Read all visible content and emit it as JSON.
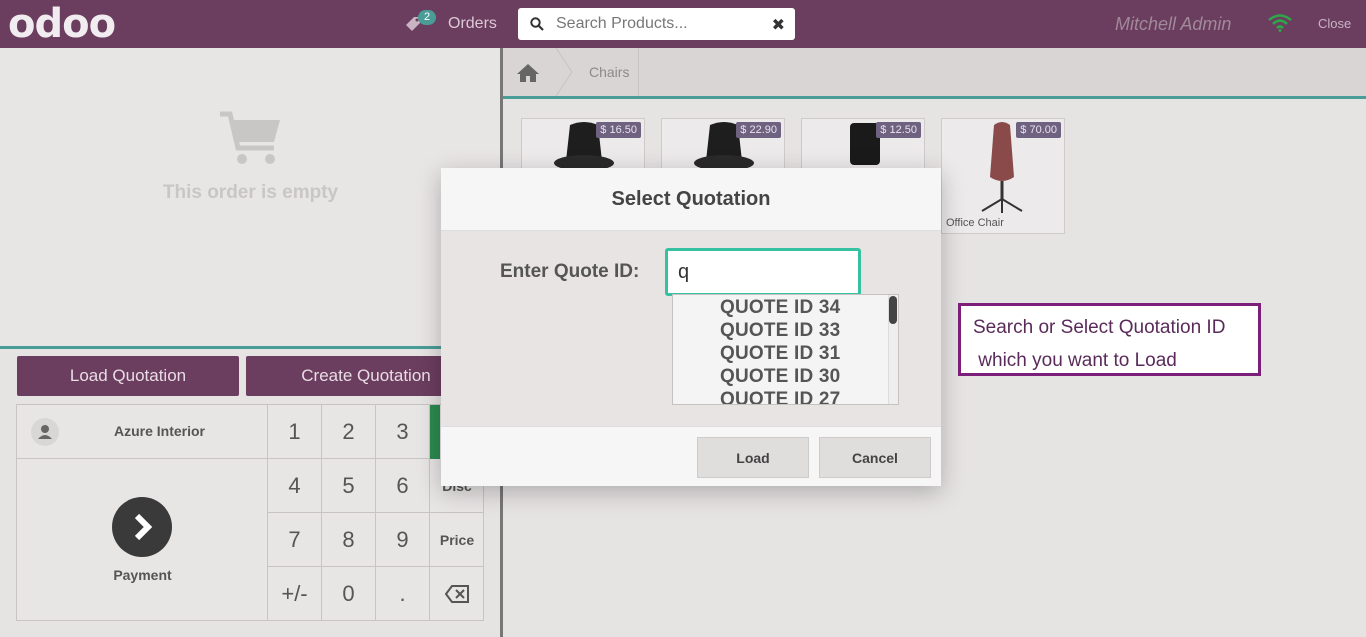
{
  "header": {
    "logo": "odoo",
    "orders_label": "Orders",
    "orders_count": "2",
    "search_placeholder": "Search Products...",
    "user": "Mitchell Admin",
    "close_label": "Close"
  },
  "order": {
    "empty_text": "This order is empty"
  },
  "actions": {
    "load_quotation": "Load Quotation",
    "create_quotation": "Create Quotation"
  },
  "pad": {
    "customer": "Azure Interior",
    "payment": "Payment",
    "keys": [
      "1",
      "2",
      "3",
      "4",
      "5",
      "6",
      "7",
      "8",
      "9",
      "+/-",
      "0",
      "."
    ],
    "disc": "Disc",
    "price": "Price",
    "backspace": "⌫"
  },
  "breadcrumb": {
    "category": "Chairs"
  },
  "products": [
    {
      "price": "$ 16.50",
      "name": ""
    },
    {
      "price": "$ 22.90",
      "name": ""
    },
    {
      "price": "$ 12.50",
      "name": ""
    },
    {
      "price": "$ 70.00",
      "name": "Office Chair"
    }
  ],
  "modal": {
    "title": "Select Quotation",
    "label": "Enter Quote ID:",
    "input_value": "q",
    "options": [
      "QUOTE ID 34",
      "QUOTE ID 33",
      "QUOTE ID 31",
      "QUOTE ID 30",
      "QUOTE ID 27"
    ],
    "load_label": "Load",
    "cancel_label": "Cancel"
  },
  "callout": {
    "line1": "Search or Select Quotation ID",
    "line2": " which you want to Load"
  },
  "colors": {
    "header": "#6b3d5f",
    "accent_teal": "#4a9c96",
    "input_focus": "#36c1a0",
    "callout_border": "#7b1f7b"
  }
}
